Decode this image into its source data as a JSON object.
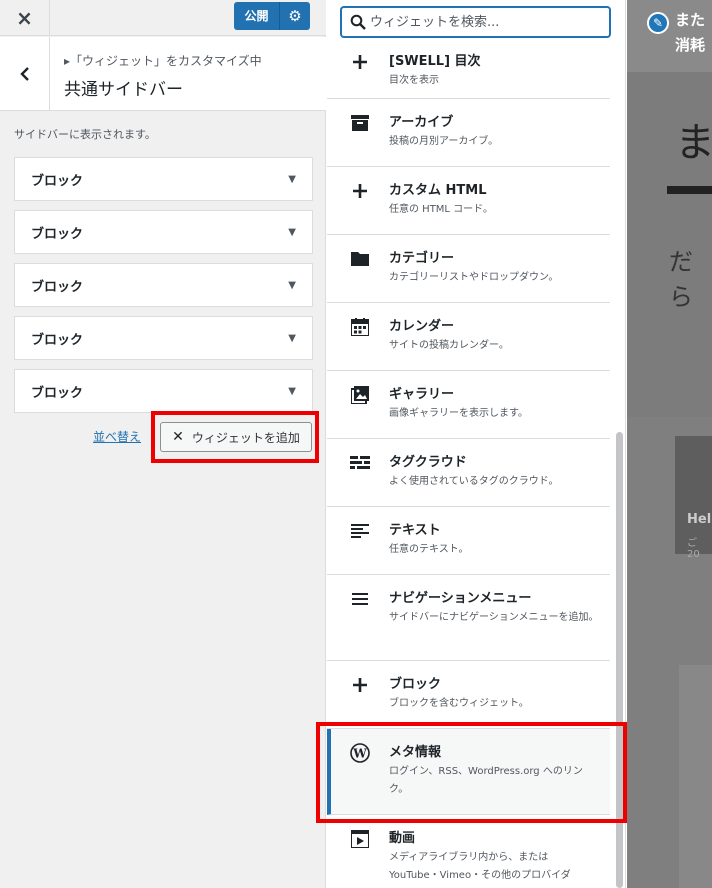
{
  "topbar": {
    "close_icon": "×",
    "publish_label": "公開",
    "gear_icon": "⚙"
  },
  "section": {
    "breadcrumb": "▸「ウィジェット」をカスタマイズ中",
    "title": "共通サイドバー",
    "description": "サイドバーに表示されます。"
  },
  "widgets": [
    {
      "title": "ブロック"
    },
    {
      "title": "ブロック"
    },
    {
      "title": "ブロック"
    },
    {
      "title": "ブロック"
    },
    {
      "title": "ブロック"
    }
  ],
  "actions": {
    "reorder_label": "並べ替え",
    "add_widget_label": "ウィジェットを追加"
  },
  "search": {
    "placeholder": "ウィジェットを検索..."
  },
  "available_widgets": [
    {
      "name": "[SWELL] 目次",
      "desc": "目次を表示",
      "icon": "plus-icon"
    },
    {
      "name": "アーカイブ",
      "desc": "投稿の月別アーカイブ。",
      "icon": "archive-icon"
    },
    {
      "name": "カスタム HTML",
      "desc": "任意の HTML コード。",
      "icon": "plus-icon"
    },
    {
      "name": "カテゴリー",
      "desc": "カテゴリーリストやドロップダウン。",
      "icon": "folder-icon"
    },
    {
      "name": "カレンダー",
      "desc": "サイトの投稿カレンダー。",
      "icon": "calendar-icon"
    },
    {
      "name": "ギャラリー",
      "desc": "画像ギャラリーを表示します。",
      "icon": "gallery-icon"
    },
    {
      "name": "タグクラウド",
      "desc": "よく使用されているタグのクラウド。",
      "icon": "tag-cloud-icon"
    },
    {
      "name": "テキスト",
      "desc": "任意のテキスト。",
      "icon": "text-icon"
    },
    {
      "name": "ナビゲーションメニュー",
      "desc": "サイドバーにナビゲーションメニューを追加。",
      "icon": "menu-icon"
    },
    {
      "name": "ブロック",
      "desc": "ブロックを含むウィジェット。",
      "icon": "plus-icon"
    },
    {
      "name": "メタ情報",
      "desc": "ログイン、RSS、WordPress.org へのリンク。",
      "icon": "wordpress-icon"
    },
    {
      "name": "動画",
      "desc": "メディアライブラリ内から、または YouTube・Vimeo・その他のプロバイダ",
      "icon": "video-icon"
    }
  ],
  "preview": {
    "header_line1": "また",
    "header_line2": "消耗",
    "heading_char": "ま",
    "subheading": "だら",
    "card_title": "Hel",
    "card_date": "ご 20"
  }
}
